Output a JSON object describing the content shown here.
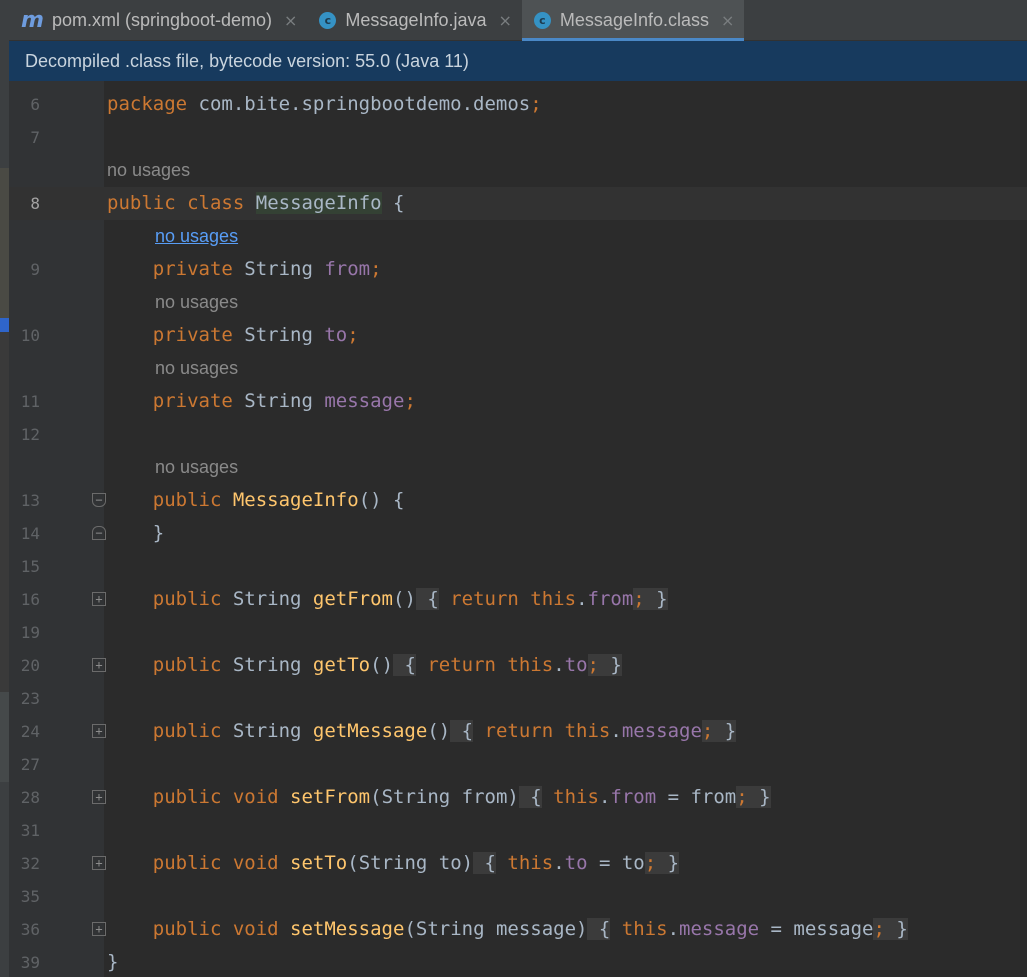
{
  "tabs": [
    {
      "icon": "m",
      "label": "pom.xml (springboot-demo)",
      "active": false
    },
    {
      "icon": "c",
      "label": "MessageInfo.java",
      "active": false
    },
    {
      "icon": "c",
      "label": "MessageInfo.class",
      "active": true
    }
  ],
  "close_glyph": "×",
  "banner": "Decompiled .class file, bytecode version: 55.0 (Java 11)",
  "hints": {
    "no_usages": "no usages"
  },
  "code": {
    "l6": {
      "num": "6",
      "kw": "package",
      "rest": " com.bite.springbootdemo.demos",
      "semi": ";"
    },
    "l7": {
      "num": "7"
    },
    "l8": {
      "num": "8",
      "kw1": "public",
      "kw2": "class",
      "name": "MessageInfo",
      "rest": " {"
    },
    "l9": {
      "num": "9",
      "kw": "private",
      "type": " String ",
      "field": "from",
      "semi": ";"
    },
    "l10": {
      "num": "10",
      "kw": "private",
      "type": " String ",
      "field": "to",
      "semi": ";"
    },
    "l11": {
      "num": "11",
      "kw": "private",
      "type": " String ",
      "field": "message",
      "semi": ";"
    },
    "l12": {
      "num": "12"
    },
    "l13": {
      "num": "13",
      "kw": "public",
      "name": "MessageInfo",
      "rest": "() {"
    },
    "l14": {
      "num": "14",
      "rest": "}"
    },
    "l15": {
      "num": "15"
    },
    "l16": {
      "num": "16",
      "kw": "public",
      "type": " String ",
      "name": "getFrom",
      "paren": "()",
      "ob": " {",
      "ret": " return",
      "this": " this",
      "dot": ".",
      "field": "from",
      "semi": ";",
      "cb": " }"
    },
    "l19": {
      "num": "19"
    },
    "l20": {
      "num": "20",
      "kw": "public",
      "type": " String ",
      "name": "getTo",
      "paren": "()",
      "ob": " {",
      "ret": " return",
      "this": " this",
      "dot": ".",
      "field": "to",
      "semi": ";",
      "cb": " }"
    },
    "l23": {
      "num": "23"
    },
    "l24": {
      "num": "24",
      "kw": "public",
      "type": " String ",
      "name": "getMessage",
      "paren": "()",
      "ob": " {",
      "ret": " return",
      "this": " this",
      "dot": ".",
      "field": "message",
      "semi": ";",
      "cb": " }"
    },
    "l27": {
      "num": "27"
    },
    "l28": {
      "num": "28",
      "kw": "public",
      "kw2": " void ",
      "name": "setFrom",
      "paren": "(String from)",
      "ob": " {",
      "this": " this",
      "dot": ".",
      "field": "from",
      "assign": " = from",
      "semi": ";",
      "cb": " }"
    },
    "l31": {
      "num": "31"
    },
    "l32": {
      "num": "32",
      "kw": "public",
      "kw2": " void ",
      "name": "setTo",
      "paren": "(String to)",
      "ob": " {",
      "this": " this",
      "dot": ".",
      "field": "to",
      "assign": " = to",
      "semi": ";",
      "cb": " }"
    },
    "l35": {
      "num": "35"
    },
    "l36": {
      "num": "36",
      "kw": "public",
      "kw2": " void ",
      "name": "setMessage",
      "paren": "(String message)",
      "ob": " {",
      "this": " this",
      "dot": ".",
      "field": "message",
      "assign": " = message",
      "semi": ";",
      "cb": " }"
    },
    "l39": {
      "num": "39",
      "rest": "}"
    }
  },
  "colors": {
    "keyword": "#cc7832",
    "field": "#9876aa",
    "method": "#ffc66d",
    "text": "#a9b7c6",
    "banner_bg": "#173a5e",
    "active_tab_underline": "#4a88c7"
  }
}
